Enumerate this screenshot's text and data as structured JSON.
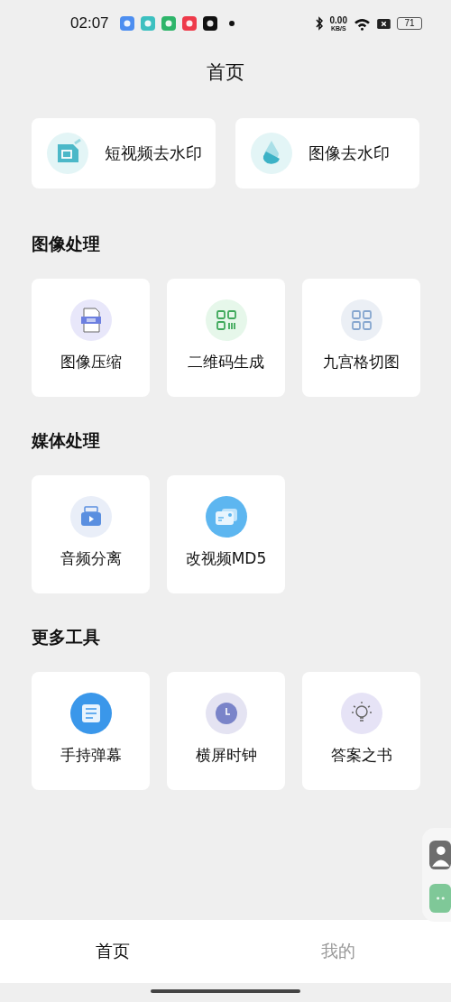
{
  "status_bar": {
    "time": "02:07",
    "net_speed": "0.00",
    "net_unit": "KB/S",
    "battery": "71"
  },
  "title": "首页",
  "featured": [
    {
      "label": "短视频去水印"
    },
    {
      "label": "图像去水印"
    }
  ],
  "sections": [
    {
      "heading": "图像处理",
      "tools": [
        {
          "label": "图像压缩"
        },
        {
          "label": "二维码生成"
        },
        {
          "label": "九宫格切图"
        }
      ]
    },
    {
      "heading": "媒体处理",
      "tools": [
        {
          "label": "音频分离"
        },
        {
          "label": "改视频MD5"
        }
      ]
    },
    {
      "heading": "更多工具",
      "tools": [
        {
          "label": "手持弹幕"
        },
        {
          "label": "横屏时钟"
        },
        {
          "label": "答案之书"
        }
      ]
    }
  ],
  "tab_bar": [
    {
      "label": "首页",
      "selected": true
    },
    {
      "label": "我的",
      "selected": false
    }
  ]
}
